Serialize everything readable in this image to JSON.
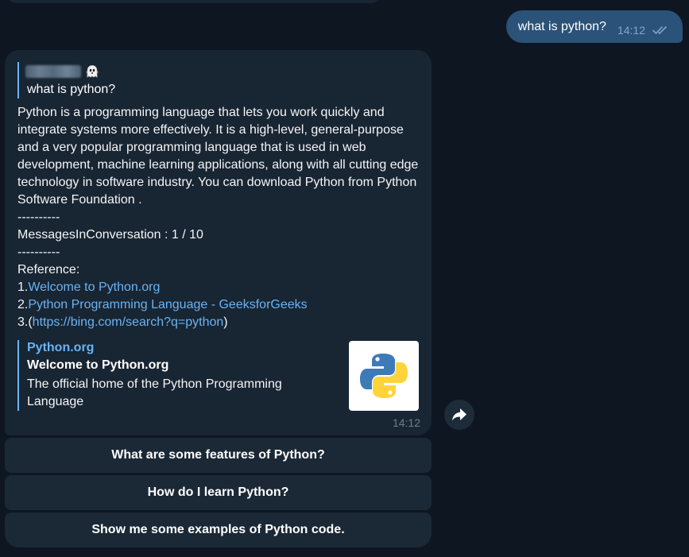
{
  "outgoing": {
    "text": "what is python?",
    "time": "14:12",
    "read_icon": "double-check-icon"
  },
  "incoming": {
    "reply": {
      "sender_emoji": "👻",
      "text": "what is python?"
    },
    "paragraph": "Python is a programming language that lets you work quickly and integrate systems more effectively. It is a high-level, general-purpose and a very popular programming language that is used in web development, machine learning applications, along with all cutting edge technology in software industry. You can download Python from Python Software Foundation .",
    "separator_1": "----------",
    "messages_count": "MessagesInConversation : 1 / 10",
    "separator_2": "----------",
    "reference_label": "Reference:",
    "references": [
      {
        "prefix": "1.",
        "text": "Welcome to Python.org",
        "suffix": ""
      },
      {
        "prefix": "2.",
        "text": "Python Programming Language - GeeksforGeeks",
        "suffix": ""
      },
      {
        "prefix": "3.(",
        "text": "https://bing.com/search?q=python",
        "suffix": ")"
      }
    ],
    "preview": {
      "site": "Python.org",
      "title": "Welcome to Python.org",
      "description": "The official home of the Python Programming Language",
      "thumbnail_icon": "python-logo-icon"
    },
    "time": "14:12"
  },
  "forward_icon": "forward-arrow-icon",
  "keyboard_buttons": [
    "What are some features of Python?",
    "How do I learn Python?",
    "Show me some examples of Python code."
  ],
  "colors": {
    "background": "#0e1621",
    "incoming_bubble": "#182533",
    "outgoing_bubble": "#2b5278",
    "link": "#6ab3f3",
    "python_blue": "#3d7ab8",
    "python_yellow": "#fed43a"
  }
}
